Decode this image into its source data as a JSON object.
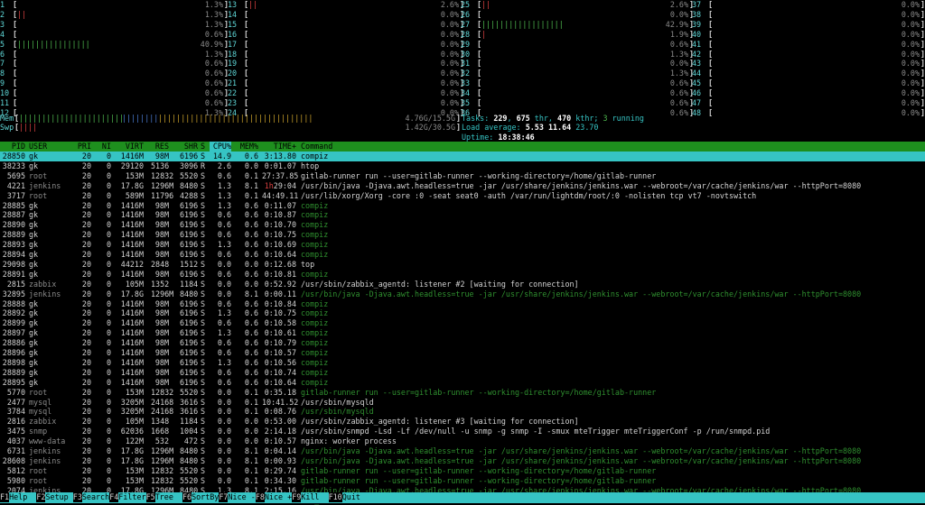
{
  "cpus_col1": [
    {
      "n": "1",
      "bar": "",
      "pct": "1.3%"
    },
    {
      "n": "2",
      "bar": "||",
      "pct": "1.3%"
    },
    {
      "n": "3",
      "bar": "",
      "pct": "1.3%"
    },
    {
      "n": "4",
      "bar": "",
      "pct": "0.6%"
    },
    {
      "n": "5",
      "bar": "||||||||||||||||",
      "pct": "40.9%"
    },
    {
      "n": "6",
      "bar": "",
      "pct": "1.3%"
    },
    {
      "n": "7",
      "bar": "",
      "pct": "0.6%"
    },
    {
      "n": "8",
      "bar": "",
      "pct": "0.6%"
    },
    {
      "n": "9",
      "bar": "",
      "pct": "0.6%"
    },
    {
      "n": "10",
      "bar": "",
      "pct": "0.6%"
    },
    {
      "n": "11",
      "bar": "",
      "pct": "0.6%"
    },
    {
      "n": "12",
      "bar": "",
      "pct": "1.3%"
    }
  ],
  "cpus_col2": [
    {
      "n": "13",
      "bar": "||",
      "pct": "2.6%"
    },
    {
      "n": "14",
      "bar": "",
      "pct": "0.0%"
    },
    {
      "n": "15",
      "bar": "",
      "pct": "0.0%"
    },
    {
      "n": "16",
      "bar": "",
      "pct": "0.0%"
    },
    {
      "n": "17",
      "bar": "",
      "pct": "0.0%"
    },
    {
      "n": "18",
      "bar": "",
      "pct": "0.0%"
    },
    {
      "n": "19",
      "bar": "",
      "pct": "0.0%"
    },
    {
      "n": "20",
      "bar": "",
      "pct": "0.0%"
    },
    {
      "n": "21",
      "bar": "",
      "pct": "0.0%"
    },
    {
      "n": "22",
      "bar": "",
      "pct": "0.0%"
    },
    {
      "n": "23",
      "bar": "",
      "pct": "0.0%"
    },
    {
      "n": "24",
      "bar": "",
      "pct": "0.0%"
    }
  ],
  "cpus_col3": [
    {
      "n": "25",
      "bar": "||",
      "pct": "2.6%"
    },
    {
      "n": "26",
      "bar": "",
      "pct": "0.0%"
    },
    {
      "n": "27",
      "bar": "||||||||||||||||||",
      "pct": "42.9%"
    },
    {
      "n": "28",
      "bar": "|",
      "pct": "1.9%"
    },
    {
      "n": "29",
      "bar": "",
      "pct": "0.6%"
    },
    {
      "n": "30",
      "bar": "",
      "pct": "1.3%"
    },
    {
      "n": "31",
      "bar": "",
      "pct": "0.0%"
    },
    {
      "n": "32",
      "bar": "",
      "pct": "1.3%"
    },
    {
      "n": "33",
      "bar": "",
      "pct": "0.6%"
    },
    {
      "n": "34",
      "bar": "",
      "pct": "0.6%"
    },
    {
      "n": "35",
      "bar": "",
      "pct": "0.6%"
    },
    {
      "n": "36",
      "bar": "",
      "pct": "0.6%"
    }
  ],
  "cpus_col4": [
    {
      "n": "37",
      "bar": "",
      "pct": "0.0%"
    },
    {
      "n": "38",
      "bar": "",
      "pct": "0.0%"
    },
    {
      "n": "39",
      "bar": "",
      "pct": "0.0%"
    },
    {
      "n": "40",
      "bar": "",
      "pct": "0.0%"
    },
    {
      "n": "41",
      "bar": "",
      "pct": "0.0%"
    },
    {
      "n": "42",
      "bar": "",
      "pct": "0.0%"
    },
    {
      "n": "43",
      "bar": "",
      "pct": "0.0%"
    },
    {
      "n": "44",
      "bar": "",
      "pct": "0.0%"
    },
    {
      "n": "45",
      "bar": "",
      "pct": "0.0%"
    },
    {
      "n": "46",
      "bar": "",
      "pct": "0.0%"
    },
    {
      "n": "47",
      "bar": "",
      "pct": "0.0%"
    },
    {
      "n": "48",
      "bar": "",
      "pct": "0.0%"
    }
  ],
  "mem": {
    "label": "Mem",
    "bar_green": "|||||||||||||||||||||||",
    "bar_blue": "||||||||",
    "bar_yellow": "||||||||||||||||||||||||||||||||||",
    "value": "4.76G/15.5G"
  },
  "swp": {
    "label": "Swp",
    "bar": "||||",
    "value": "1.42G/30.5G"
  },
  "tasks": {
    "label": "Tasks:",
    "count": "229",
    "sep1": ",",
    "thr": "675",
    "thr_label": "thr,",
    "kthr": "470",
    "kthr_label": "kthr;",
    "running": "3",
    "running_label": "running"
  },
  "load": {
    "label": "Load average:",
    "v1": "5.53",
    "v2": "11.64",
    "v3": "23.70"
  },
  "uptime": {
    "label": "Uptime:",
    "value": "18:38:46"
  },
  "columns": [
    "PID",
    "USER",
    "PRI",
    "NI",
    "VIRT",
    "RES",
    "SHR",
    "S",
    "CPU%",
    "MEM%",
    "TIME+",
    "Command"
  ],
  "processes": [
    {
      "pid": "28850",
      "user": "gk",
      "pri": "20",
      "ni": "0",
      "virt": "1416M",
      "res": "98M",
      "shr": "6196",
      "s": "S",
      "cpu": "14.9",
      "mem": "0.6",
      "time": "3:13.80",
      "cmd": "compiz",
      "sel": true
    },
    {
      "pid": "38233",
      "user": "gk",
      "pri": "20",
      "ni": "0",
      "virt": "29120",
      "res": "5136",
      "shr": "3096",
      "s": "R",
      "cpu": "2.6",
      "mem": "0.0",
      "time": "0:01.07",
      "cmd": "htop"
    },
    {
      "pid": "5695",
      "user": "root",
      "pri": "20",
      "ni": "0",
      "virt": "153M",
      "res": "12832",
      "shr": "5520",
      "s": "S",
      "cpu": "0.6",
      "mem": "0.1",
      "time": "27:37.85",
      "cmd": "gitlab-runner run --user=gitlab-runner --working-directory=/home/gitlab-runner"
    },
    {
      "pid": "4221",
      "user": "jenkins",
      "pri": "20",
      "ni": "0",
      "virt": "17.8G",
      "res": "1296M",
      "shr": "8480",
      "s": "S",
      "cpu": "1.3",
      "mem": "8.1",
      "time": "1h29:04",
      "cmd": "/usr/bin/java -Djava.awt.headless=true -jar /usr/share/jenkins/jenkins.war --webroot=/var/cache/jenkins/war --httpPort=8080"
    },
    {
      "pid": "3717",
      "user": "root",
      "pri": "20",
      "ni": "0",
      "virt": "589M",
      "res": "11796",
      "shr": "4288",
      "s": "S",
      "cpu": "1.3",
      "mem": "0.1",
      "time": "44:49.11",
      "cmd": "/usr/lib/xorg/Xorg -core :0 -seat seat0 -auth /var/run/lightdm/root/:0 -nolisten tcp vt7 -novtswitch"
    },
    {
      "pid": "28885",
      "user": "gk",
      "pri": "20",
      "ni": "0",
      "virt": "1416M",
      "res": "98M",
      "shr": "6196",
      "s": "S",
      "cpu": "1.3",
      "mem": "0.6",
      "time": "0:11.07",
      "cmd": "compiz",
      "dim": true
    },
    {
      "pid": "28887",
      "user": "gk",
      "pri": "20",
      "ni": "0",
      "virt": "1416M",
      "res": "98M",
      "shr": "6196",
      "s": "S",
      "cpu": "0.6",
      "mem": "0.6",
      "time": "0:10.87",
      "cmd": "compiz",
      "dim": true
    },
    {
      "pid": "28890",
      "user": "gk",
      "pri": "20",
      "ni": "0",
      "virt": "1416M",
      "res": "98M",
      "shr": "6196",
      "s": "S",
      "cpu": "0.6",
      "mem": "0.6",
      "time": "0:10.70",
      "cmd": "compiz",
      "dim": true
    },
    {
      "pid": "28889",
      "user": "gk",
      "pri": "20",
      "ni": "0",
      "virt": "1416M",
      "res": "98M",
      "shr": "6196",
      "s": "S",
      "cpu": "0.6",
      "mem": "0.6",
      "time": "0:10.75",
      "cmd": "compiz",
      "dim": true
    },
    {
      "pid": "28893",
      "user": "gk",
      "pri": "20",
      "ni": "0",
      "virt": "1416M",
      "res": "98M",
      "shr": "6196",
      "s": "S",
      "cpu": "1.3",
      "mem": "0.6",
      "time": "0:10.69",
      "cmd": "compiz",
      "dim": true
    },
    {
      "pid": "28894",
      "user": "gk",
      "pri": "20",
      "ni": "0",
      "virt": "1416M",
      "res": "98M",
      "shr": "6196",
      "s": "S",
      "cpu": "0.6",
      "mem": "0.6",
      "time": "0:10.64",
      "cmd": "compiz",
      "dim": true
    },
    {
      "pid": "29098",
      "user": "gk",
      "pri": "20",
      "ni": "0",
      "virt": "44212",
      "res": "2848",
      "shr": "1512",
      "s": "S",
      "cpu": "0.0",
      "mem": "0.0",
      "time": "0:12.68",
      "cmd": "top"
    },
    {
      "pid": "28891",
      "user": "gk",
      "pri": "20",
      "ni": "0",
      "virt": "1416M",
      "res": "98M",
      "shr": "6196",
      "s": "S",
      "cpu": "0.6",
      "mem": "0.6",
      "time": "0:10.81",
      "cmd": "compiz",
      "dim": true
    },
    {
      "pid": "2815",
      "user": "zabbix",
      "pri": "20",
      "ni": "0",
      "virt": "105M",
      "res": "1352",
      "shr": "1184",
      "s": "S",
      "cpu": "0.0",
      "mem": "0.0",
      "time": "0:52.92",
      "cmd": "/usr/sbin/zabbix_agentd: listener #2 [waiting for connection]"
    },
    {
      "pid": "32895",
      "user": "jenkins",
      "pri": "20",
      "ni": "0",
      "virt": "17.8G",
      "res": "1296M",
      "shr": "8480",
      "s": "S",
      "cpu": "0.0",
      "mem": "8.1",
      "time": "0:00.11",
      "cmd": "/usr/bin/java -Djava.awt.headless=true -jar /usr/share/jenkins/jenkins.war --webroot=/var/cache/jenkins/war --httpPort=8080",
      "dim": true
    },
    {
      "pid": "28888",
      "user": "gk",
      "pri": "20",
      "ni": "0",
      "virt": "1416M",
      "res": "98M",
      "shr": "6196",
      "s": "S",
      "cpu": "0.6",
      "mem": "0.6",
      "time": "0:10.84",
      "cmd": "compiz",
      "dim": true
    },
    {
      "pid": "28892",
      "user": "gk",
      "pri": "20",
      "ni": "0",
      "virt": "1416M",
      "res": "98M",
      "shr": "6196",
      "s": "S",
      "cpu": "1.3",
      "mem": "0.6",
      "time": "0:10.75",
      "cmd": "compiz",
      "dim": true
    },
    {
      "pid": "28899",
      "user": "gk",
      "pri": "20",
      "ni": "0",
      "virt": "1416M",
      "res": "98M",
      "shr": "6196",
      "s": "S",
      "cpu": "0.6",
      "mem": "0.6",
      "time": "0:10.58",
      "cmd": "compiz",
      "dim": true
    },
    {
      "pid": "28897",
      "user": "gk",
      "pri": "20",
      "ni": "0",
      "virt": "1416M",
      "res": "98M",
      "shr": "6196",
      "s": "S",
      "cpu": "1.3",
      "mem": "0.6",
      "time": "0:10.61",
      "cmd": "compiz",
      "dim": true
    },
    {
      "pid": "28886",
      "user": "gk",
      "pri": "20",
      "ni": "0",
      "virt": "1416M",
      "res": "98M",
      "shr": "6196",
      "s": "S",
      "cpu": "0.6",
      "mem": "0.6",
      "time": "0:10.79",
      "cmd": "compiz",
      "dim": true
    },
    {
      "pid": "28896",
      "user": "gk",
      "pri": "20",
      "ni": "0",
      "virt": "1416M",
      "res": "98M",
      "shr": "6196",
      "s": "S",
      "cpu": "0.6",
      "mem": "0.6",
      "time": "0:10.57",
      "cmd": "compiz",
      "dim": true
    },
    {
      "pid": "28898",
      "user": "gk",
      "pri": "20",
      "ni": "0",
      "virt": "1416M",
      "res": "98M",
      "shr": "6196",
      "s": "S",
      "cpu": "1.3",
      "mem": "0.6",
      "time": "0:10.56",
      "cmd": "compiz",
      "dim": true
    },
    {
      "pid": "28889",
      "user": "gk",
      "pri": "20",
      "ni": "0",
      "virt": "1416M",
      "res": "98M",
      "shr": "6196",
      "s": "S",
      "cpu": "0.6",
      "mem": "0.6",
      "time": "0:10.74",
      "cmd": "compiz",
      "dim": true
    },
    {
      "pid": "28895",
      "user": "gk",
      "pri": "20",
      "ni": "0",
      "virt": "1416M",
      "res": "98M",
      "shr": "6196",
      "s": "S",
      "cpu": "0.6",
      "mem": "0.6",
      "time": "0:10.64",
      "cmd": "compiz",
      "dim": true
    },
    {
      "pid": "5770",
      "user": "root",
      "pri": "20",
      "ni": "0",
      "virt": "153M",
      "res": "12832",
      "shr": "5520",
      "s": "S",
      "cpu": "0.0",
      "mem": "0.1",
      "time": "0:35.18",
      "cmd": "gitlab-runner run --user=gitlab-runner --working-directory=/home/gitlab-runner",
      "dim": true
    },
    {
      "pid": "2477",
      "user": "mysql",
      "pri": "20",
      "ni": "0",
      "virt": "3205M",
      "res": "24168",
      "shr": "3616",
      "s": "S",
      "cpu": "0.0",
      "mem": "0.1",
      "time": "10:41.52",
      "cmd": "/usr/sbin/mysqld"
    },
    {
      "pid": "3784",
      "user": "mysql",
      "pri": "20",
      "ni": "0",
      "virt": "3205M",
      "res": "24168",
      "shr": "3616",
      "s": "S",
      "cpu": "0.0",
      "mem": "0.1",
      "time": "0:08.76",
      "cmd": "/usr/sbin/mysqld",
      "dim": true
    },
    {
      "pid": "2816",
      "user": "zabbix",
      "pri": "20",
      "ni": "0",
      "virt": "105M",
      "res": "1348",
      "shr": "1184",
      "s": "S",
      "cpu": "0.0",
      "mem": "0.0",
      "time": "0:53.00",
      "cmd": "/usr/sbin/zabbix_agentd: listener #3 [waiting for connection]"
    },
    {
      "pid": "3475",
      "user": "snmp",
      "pri": "20",
      "ni": "0",
      "virt": "62036",
      "res": "1668",
      "shr": "1004",
      "s": "S",
      "cpu": "0.0",
      "mem": "0.0",
      "time": "2:14.18",
      "cmd": "/usr/sbin/snmpd -Lsd -Lf /dev/null -u snmp -g snmp -I -smux mteTrigger mteTriggerConf -p /run/snmpd.pid"
    },
    {
      "pid": "4037",
      "user": "www-data",
      "pri": "20",
      "ni": "0",
      "virt": "122M",
      "res": "532",
      "shr": "472",
      "s": "S",
      "cpu": "0.0",
      "mem": "0.0",
      "time": "0:10.57",
      "cmd": "nginx: worker process"
    },
    {
      "pid": "6731",
      "user": "jenkins",
      "pri": "20",
      "ni": "0",
      "virt": "17.8G",
      "res": "1296M",
      "shr": "8480",
      "s": "S",
      "cpu": "0.0",
      "mem": "8.1",
      "time": "0:04.14",
      "cmd": "/usr/bin/java -Djava.awt.headless=true -jar /usr/share/jenkins/jenkins.war --webroot=/var/cache/jenkins/war --httpPort=8080",
      "dim": true
    },
    {
      "pid": "28608",
      "user": "jenkins",
      "pri": "20",
      "ni": "0",
      "virt": "17.8G",
      "res": "1296M",
      "shr": "8480",
      "s": "S",
      "cpu": "0.0",
      "mem": "8.1",
      "time": "0:00.93",
      "cmd": "/usr/bin/java -Djava.awt.headless=true -jar /usr/share/jenkins/jenkins.war --webroot=/var/cache/jenkins/war --httpPort=8080",
      "dim": true
    },
    {
      "pid": "5812",
      "user": "root",
      "pri": "20",
      "ni": "0",
      "virt": "153M",
      "res": "12832",
      "shr": "5520",
      "s": "S",
      "cpu": "0.0",
      "mem": "0.1",
      "time": "0:29.74",
      "cmd": "gitlab-runner run --user=gitlab-runner --working-directory=/home/gitlab-runner",
      "dim": true
    },
    {
      "pid": "5980",
      "user": "root",
      "pri": "20",
      "ni": "0",
      "virt": "153M",
      "res": "12832",
      "shr": "5520",
      "s": "S",
      "cpu": "0.0",
      "mem": "0.1",
      "time": "0:34.30",
      "cmd": "gitlab-runner run --user=gitlab-runner --working-directory=/home/gitlab-runner",
      "dim": true
    },
    {
      "pid": "2074",
      "user": "jenkins",
      "pri": "20",
      "ni": "0",
      "virt": "17.8G",
      "res": "1296M",
      "shr": "8480",
      "s": "S",
      "cpu": "1.3",
      "mem": "8.1",
      "time": "2:15.16",
      "cmd": "/usr/bin/java -Djava.awt.headless=true -jar /usr/share/jenkins/jenkins.war --webroot=/var/cache/jenkins/war --httpPort=8080",
      "dim": true
    },
    {
      "pid": "12",
      "user": "root",
      "pri": "20",
      "ni": "0",
      "virt": "0",
      "res": "0",
      "shr": "0",
      "s": "I",
      "cpu": "0.0",
      "mem": "0.0",
      "time": "1:22.62",
      "cmd": "rcu_sched",
      "dim": true
    }
  ],
  "footer": [
    {
      "key": "F1",
      "label": "Help"
    },
    {
      "key": "F2",
      "label": "Setup"
    },
    {
      "key": "F3",
      "label": "Search"
    },
    {
      "key": "F4",
      "label": "Filter"
    },
    {
      "key": "F5",
      "label": "Tree"
    },
    {
      "key": "F6",
      "label": "SortBy"
    },
    {
      "key": "F7",
      "label": "Nice -"
    },
    {
      "key": "F8",
      "label": "Nice +"
    },
    {
      "key": "F9",
      "label": "Kill"
    },
    {
      "key": "F10",
      "label": "Quit"
    }
  ]
}
